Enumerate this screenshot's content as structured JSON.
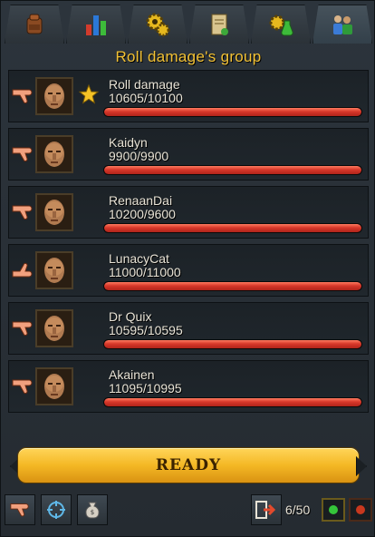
{
  "group": {
    "title": "Roll damage's group"
  },
  "tabs": [
    {
      "icon": "backpack-icon"
    },
    {
      "icon": "stats-chart-icon"
    },
    {
      "icon": "settings-gear-icon"
    },
    {
      "icon": "scroll-quest-icon"
    },
    {
      "icon": "potion-gear-icon"
    },
    {
      "icon": "group-people-icon",
      "active": true
    }
  ],
  "members": [
    {
      "name": "Roll damage",
      "hp": "10605/10100",
      "fill": 1.0,
      "leader": true,
      "thumb": "down"
    },
    {
      "name": "Kaidyn",
      "hp": "9900/9900",
      "fill": 1.0,
      "leader": false,
      "thumb": "down"
    },
    {
      "name": "RenaanDai",
      "hp": "10200/9600",
      "fill": 1.0,
      "leader": false,
      "thumb": "down"
    },
    {
      "name": "LunacyCat",
      "hp": "11000/11000",
      "fill": 1.0,
      "leader": false,
      "thumb": "up"
    },
    {
      "name": "Dr Quix",
      "hp": "10595/10595",
      "fill": 1.0,
      "leader": false,
      "thumb": "down"
    },
    {
      "name": "Akainen",
      "hp": "11095/10995",
      "fill": 1.0,
      "leader": false,
      "thumb": "down"
    }
  ],
  "ready_label": "READY",
  "footer": {
    "count": "6/50",
    "dot_green": "#35c53a",
    "dot_red": "#c8381e"
  }
}
